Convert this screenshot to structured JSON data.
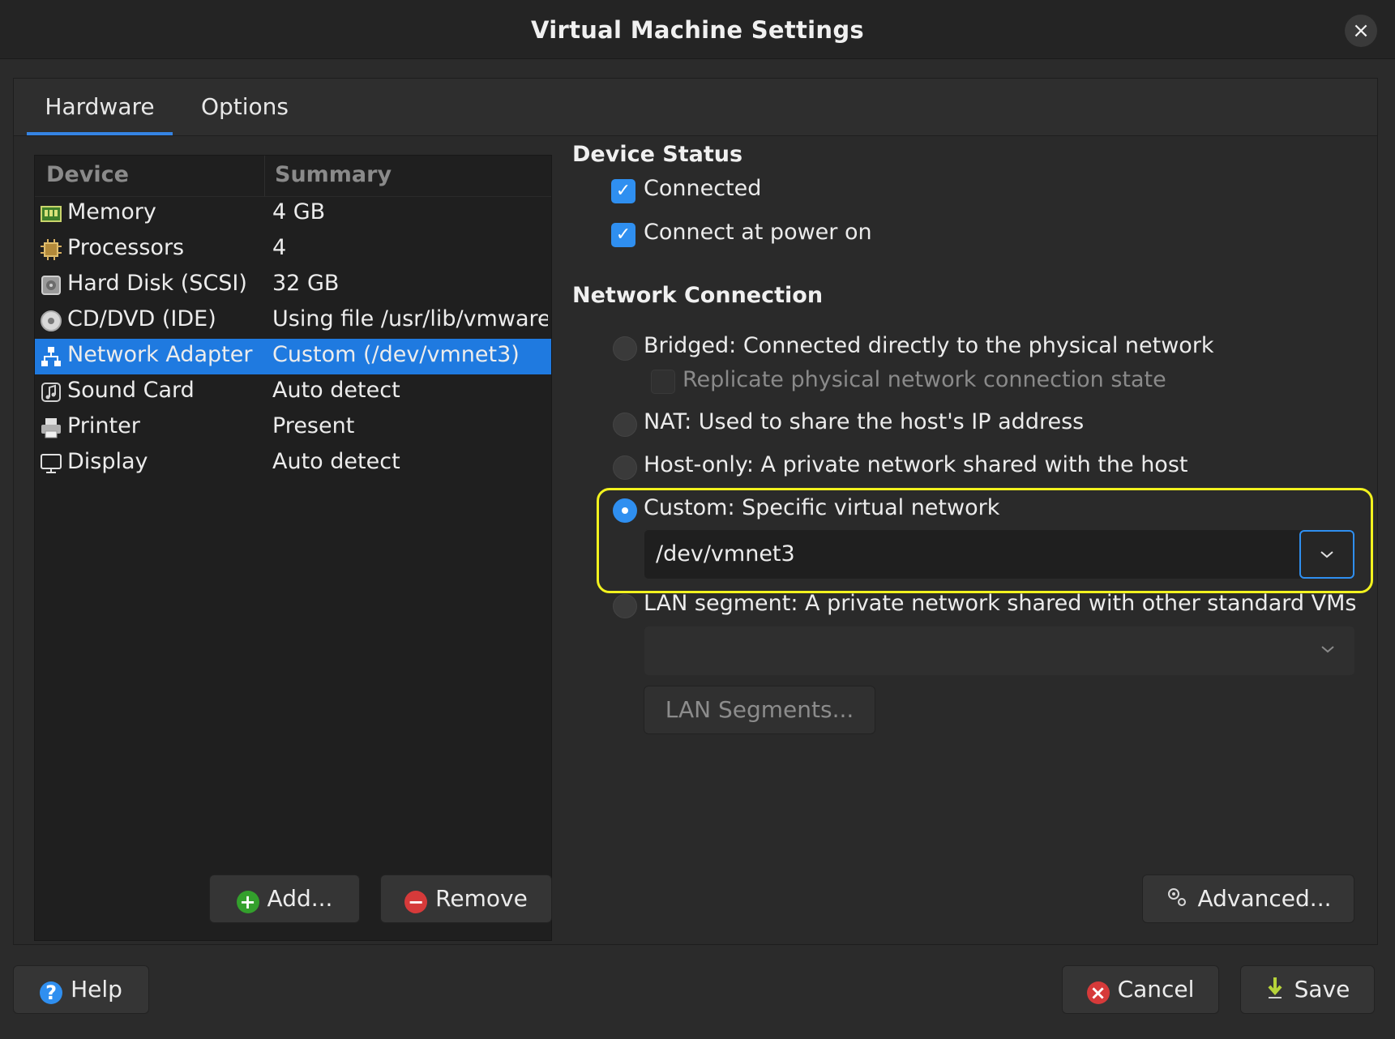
{
  "window": {
    "title": "Virtual Machine Settings",
    "close_label": "×"
  },
  "tabs": [
    {
      "label": "Hardware"
    },
    {
      "label": "Options"
    }
  ],
  "device_list": {
    "headers": {
      "device": "Device",
      "summary": "Summary"
    },
    "rows": [
      {
        "icon": "memory-icon",
        "name": "Memory",
        "summary": "4 GB"
      },
      {
        "icon": "processor-icon",
        "name": "Processors",
        "summary": "4"
      },
      {
        "icon": "hard-disk-icon",
        "name": "Hard Disk (SCSI)",
        "summary": "32 GB"
      },
      {
        "icon": "cd-dvd-icon",
        "name": "CD/DVD (IDE)",
        "summary": "Using file /usr/lib/vmware/isoimages/linux.iso"
      },
      {
        "icon": "network-icon",
        "name": "Network Adapter",
        "summary": "Custom (/dev/vmnet3)",
        "selected": true
      },
      {
        "icon": "sound-card-icon",
        "name": "Sound Card",
        "summary": "Auto detect"
      },
      {
        "icon": "printer-icon",
        "name": "Printer",
        "summary": "Present"
      },
      {
        "icon": "display-icon",
        "name": "Display",
        "summary": "Auto detect"
      }
    ],
    "add_label": "Add...",
    "remove_label": "Remove"
  },
  "device_status": {
    "title": "Device Status",
    "connected": {
      "label": "Connected",
      "checked": true
    },
    "connect_at_power_on": {
      "label": "Connect at power on",
      "checked": true
    }
  },
  "network_connection": {
    "title": "Network Connection",
    "bridged": {
      "label": "Bridged: Connected directly to the physical network",
      "selected": false
    },
    "replicate": {
      "label": "Replicate physical network connection state",
      "checked": false,
      "disabled": true
    },
    "nat": {
      "label": "NAT: Used to share the host's IP address",
      "selected": false
    },
    "host_only": {
      "label": "Host-only: A private network shared with the host",
      "selected": false
    },
    "custom": {
      "label": "Custom: Specific virtual network",
      "selected": true,
      "value": "/dev/vmnet3"
    },
    "lan_segment": {
      "label": "LAN segment: A private network shared with other standard VMs",
      "selected": false,
      "value": ""
    },
    "lan_segments_button": "LAN Segments...",
    "advanced_button": "Advanced..."
  },
  "footer": {
    "help_label": "Help",
    "cancel_label": "Cancel",
    "save_label": "Save"
  },
  "colors": {
    "accent": "#3584e4",
    "selection": "#1f7ae0",
    "highlight_box": "#f2f21e"
  }
}
